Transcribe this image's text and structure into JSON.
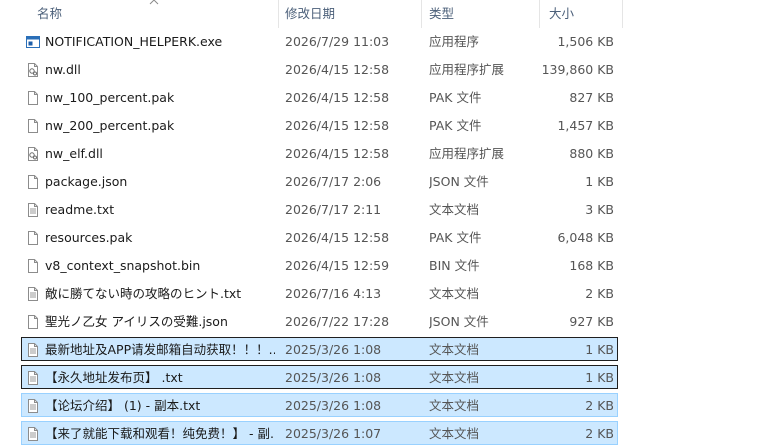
{
  "columns": {
    "name": "名称",
    "modified": "修改日期",
    "type": "类型",
    "size": "大小"
  },
  "files": [
    {
      "name": "NOTIFICATION_HELPERK.exe",
      "modified": "2026/7/29 11:03",
      "type": "应用程序",
      "size": "1,506 KB",
      "icon": "exe-icon",
      "selected": false
    },
    {
      "name": "nw.dll",
      "modified": "2026/4/15 12:58",
      "type": "应用程序扩展",
      "size": "139,860 KB",
      "icon": "dll-icon",
      "selected": false
    },
    {
      "name": "nw_100_percent.pak",
      "modified": "2026/4/15 12:58",
      "type": "PAK 文件",
      "size": "827 KB",
      "icon": "file-icon",
      "selected": false
    },
    {
      "name": "nw_200_percent.pak",
      "modified": "2026/4/15 12:58",
      "type": "PAK 文件",
      "size": "1,457 KB",
      "icon": "file-icon",
      "selected": false
    },
    {
      "name": "nw_elf.dll",
      "modified": "2026/4/15 12:58",
      "type": "应用程序扩展",
      "size": "880 KB",
      "icon": "dll-icon",
      "selected": false
    },
    {
      "name": "package.json",
      "modified": "2026/7/17 2:06",
      "type": "JSON 文件",
      "size": "1 KB",
      "icon": "file-icon",
      "selected": false
    },
    {
      "name": "readme.txt",
      "modified": "2026/7/17 2:11",
      "type": "文本文档",
      "size": "3 KB",
      "icon": "text-file-icon",
      "selected": false
    },
    {
      "name": "resources.pak",
      "modified": "2026/4/15 12:58",
      "type": "PAK 文件",
      "size": "6,048 KB",
      "icon": "file-icon",
      "selected": false
    },
    {
      "name": "v8_context_snapshot.bin",
      "modified": "2026/4/15 12:59",
      "type": "BIN 文件",
      "size": "168 KB",
      "icon": "file-icon",
      "selected": false
    },
    {
      "name": "敵に勝てない時の攻略のヒント.txt",
      "modified": "2026/7/16 4:13",
      "type": "文本文档",
      "size": "2 KB",
      "icon": "text-file-icon",
      "selected": false
    },
    {
      "name": "聖光ノ乙女 アイリスの受難.json",
      "modified": "2026/7/22 17:28",
      "type": "JSON 文件",
      "size": "927 KB",
      "icon": "file-icon",
      "selected": false
    },
    {
      "name": "最新地址及APP请发邮箱自动获取！！！...",
      "modified": "2025/3/26 1:08",
      "type": "文本文档",
      "size": "1 KB",
      "icon": "text-file-icon",
      "selected": true,
      "focus": true
    },
    {
      "name": "【永久地址发布页】 .txt",
      "modified": "2025/3/26 1:08",
      "type": "文本文档",
      "size": "1 KB",
      "icon": "text-file-icon",
      "selected": true,
      "focus": true
    },
    {
      "name": "【论坛介绍】 (1) - 副本.txt",
      "modified": "2025/3/26 1:08",
      "type": "文本文档",
      "size": "2 KB",
      "icon": "text-file-icon",
      "selected": true,
      "focus": false
    },
    {
      "name": "【来了就能下载和观看！纯免费！】 - 副...",
      "modified": "2025/3/26 1:07",
      "type": "文本文档",
      "size": "2 KB",
      "icon": "text-file-icon",
      "selected": true,
      "focus": false
    }
  ]
}
